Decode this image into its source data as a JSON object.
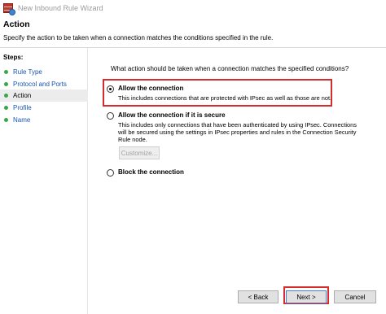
{
  "window": {
    "title": "New Inbound Rule Wizard"
  },
  "header": {
    "title": "Action",
    "description": "Specify the action to be taken when a connection matches the conditions specified in the rule."
  },
  "steps": {
    "title": "Steps:",
    "items": [
      {
        "label": "Rule Type"
      },
      {
        "label": "Protocol and Ports"
      },
      {
        "label": "Action"
      },
      {
        "label": "Profile"
      },
      {
        "label": "Name"
      }
    ]
  },
  "main": {
    "question": "What action should be taken when a connection matches the specified conditions?",
    "options": [
      {
        "title": "Allow the connection",
        "description": [
          "This includes connections that are protected with IPsec as well as those are not."
        ],
        "selected": true
      },
      {
        "title": "Allow the connection if it is secure",
        "description": [
          "This includes only connections that have been authenticated by using IPsec.  Connections",
          "will be secured using the settings in IPsec properties and rules in the Connection Security",
          "Rule node."
        ],
        "selected": false
      },
      {
        "title": "Block the connection",
        "description": [],
        "selected": false
      }
    ],
    "customize_label": "Customize..."
  },
  "footer": {
    "back_label": "< Back",
    "next_label": "Next >",
    "cancel_label": "Cancel"
  },
  "colors": {
    "highlight": "#d62c2c",
    "step_dot": "#36a84a",
    "step_link": "#1a55b0"
  }
}
